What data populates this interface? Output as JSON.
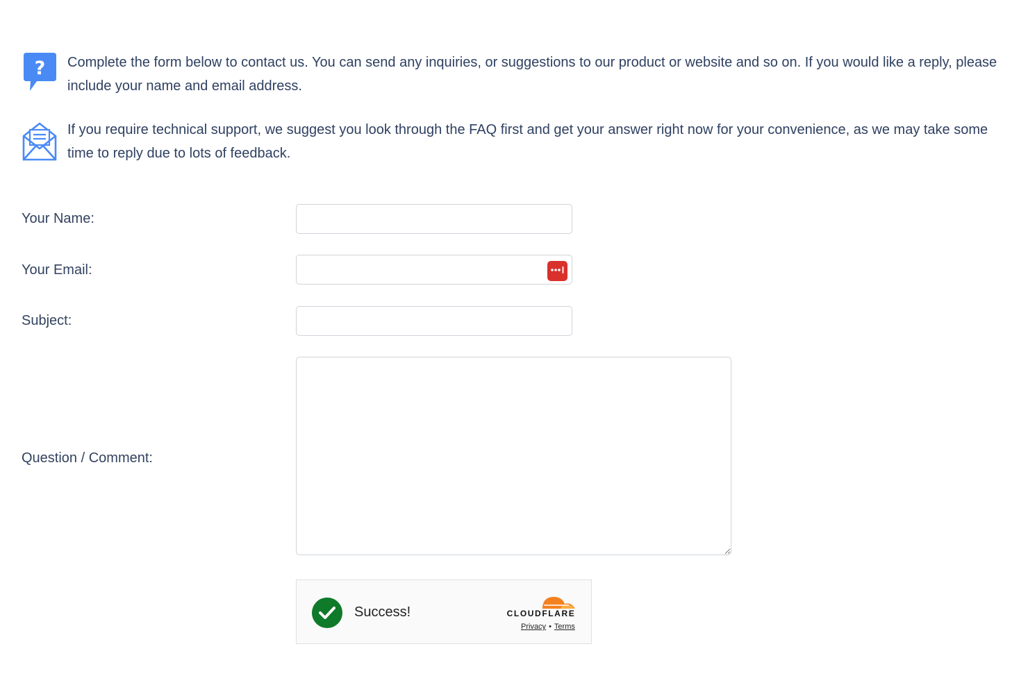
{
  "intro": {
    "paragraph_1": "Complete the form below to contact us. You can send any inquiries, or suggestions to our product or website and so on. If you would like a reply, please include your name and email address.",
    "paragraph_2": "If you require technical support, we suggest you look through the FAQ first and get your answer right now for your convenience, as we may take some time to reply due to lots of feedback.",
    "icon_1": "question-bubble-icon",
    "icon_2": "open-envelope-icon"
  },
  "form": {
    "name_label": "Your Name:",
    "name_value": "",
    "email_label": "Your Email:",
    "email_value": "",
    "subject_label": "Subject:",
    "subject_value": "",
    "comment_label": "Question / Comment:",
    "comment_value": ""
  },
  "password_manager": {
    "icon": "password-dots-icon",
    "color": "#d9302c"
  },
  "captcha": {
    "status": "Success!",
    "provider": "CLOUDFLARE",
    "privacy_link": "Privacy",
    "separator": "•",
    "terms_link": "Terms",
    "status_color": "#0f7a2a",
    "brand_color": "#f48120"
  },
  "colors": {
    "accent_blue": "#4a8af4",
    "text": "#33425f",
    "border": "#cfd3d9"
  }
}
